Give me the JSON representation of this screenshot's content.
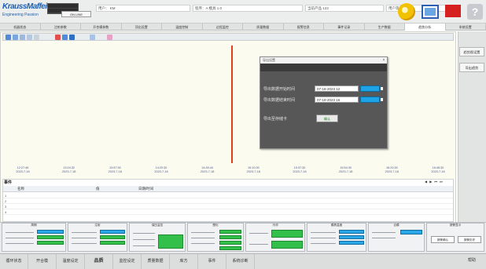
{
  "header": {
    "logo": "KraussMaffei",
    "logo_sub": "Engineering Passion",
    "mini_button": "ON LINE",
    "fields": [
      "用户： KM",
      "程序：A 模具 1.0",
      "当前产品 123",
      "用户等级： 3"
    ],
    "help_label": "?"
  },
  "tabs": [
    "机器状态",
    "注射参数",
    "开合模参数",
    "顶出设置",
    "温度控制",
    "过程监控",
    "质量数据",
    "报警信息",
    "事件记录",
    "生产数据",
    "趋势分析",
    "系统设置"
  ],
  "dialog": {
    "title": "导出设置",
    "close": "×",
    "start_label": "导出数据开始时间",
    "start_value": "07-18-2023 12",
    "end_label": "导出数据结束时间",
    "end_value": "07-18-2023 16",
    "save_label": "导出至存储卡",
    "save_button": "确认"
  },
  "axis_ticks": [
    {
      "time": "12:27:46",
      "date": "2023-7-18"
    },
    {
      "time": "13:24:32",
      "date": "2023-7-18"
    },
    {
      "time": "13:57:30",
      "date": "2023-7-18"
    },
    {
      "time": "14:20:30",
      "date": "2023-7-18"
    },
    {
      "time": "14:45:44",
      "date": "2023-7-18"
    },
    {
      "time": "15:10:30",
      "date": "2023-7-18"
    },
    {
      "time": "15:37:30",
      "date": "2023-7-18"
    },
    {
      "time": "15:54:30",
      "date": "2023-7-18"
    },
    {
      "time": "16:20:30",
      "date": "2023-7-18"
    },
    {
      "time": "16:48:30",
      "date": "2023-7-18"
    }
  ],
  "event_list": {
    "title": "事件",
    "nav": "◀ ▶ ⏮ ⏭",
    "columns": [
      "名称",
      "值",
      "日期/时间"
    ],
    "rows": [
      "1",
      "2",
      "3",
      "4"
    ]
  },
  "right_panel": [
    "趋势图设置",
    "导出趋势"
  ],
  "status_panels": [
    {
      "title": "周期"
    },
    {
      "title": "注射"
    },
    {
      "title": "保压监控"
    },
    {
      "title": "塑化"
    },
    {
      "title": "冷却"
    },
    {
      "title": "模具温度"
    },
    {
      "title": "合模"
    },
    {
      "title": "报警显示",
      "buttons": [
        "报警确认",
        "报警历史"
      ]
    }
  ],
  "bottom_nav": [
    "循环状态",
    "开合模",
    "温度设定",
    "品质",
    "监控设定",
    "质量数据",
    "库方",
    "事件",
    "系统诊断"
  ],
  "bottom_right": "帮助",
  "colors": {
    "accent_blue": "#1ea3e6",
    "status_green": "#33c04a",
    "cursor_red": "#e2401b"
  }
}
